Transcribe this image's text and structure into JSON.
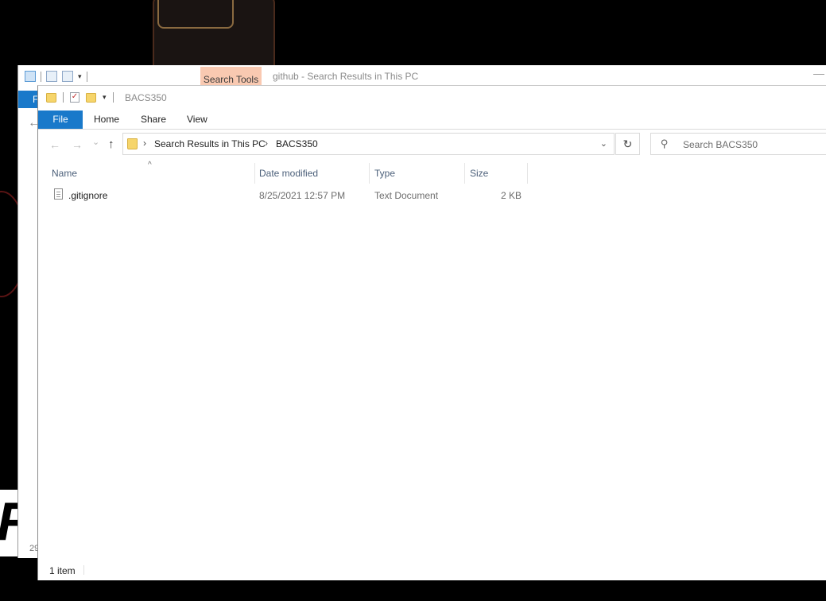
{
  "background_window": {
    "ribbon_context_tab": "Search Tools",
    "title": "github - Search Results in This PC",
    "file_tab_label": "F",
    "partial_status": "29",
    "minimize_glyph": "—",
    "back_glyph": "←"
  },
  "window": {
    "title": "BACS350",
    "qat_dropdown_glyph": "▾"
  },
  "ribbon": {
    "tabs": [
      "File",
      "Home",
      "Share",
      "View"
    ]
  },
  "nav": {
    "back_glyph": "←",
    "forward_glyph": "→",
    "recent_glyph": "⌄",
    "up_glyph": "↑"
  },
  "address": {
    "separator": "›",
    "crumbs": [
      "Search Results in This PC",
      "BACS350"
    ],
    "dropdown_glyph": "⌄",
    "refresh_glyph": "↻"
  },
  "search": {
    "placeholder": "Search BACS350",
    "icon_glyph": "⚲"
  },
  "columns": {
    "sort_glyph": "^",
    "headers": [
      "Name",
      "Date modified",
      "Type",
      "Size"
    ]
  },
  "files": [
    {
      "name": ".gitignore",
      "date": "8/25/2021 12:57 PM",
      "type": "Text Document",
      "size": "2 KB",
      "icon": "text-document-icon"
    }
  ],
  "status": {
    "count": "1 item"
  },
  "wallpaper": {
    "glyph": "R"
  },
  "colors": {
    "accent": "#1979ca",
    "context_tab": "#f9c9b1",
    "folder": "#f6d56b",
    "header_text": "#4c607a"
  }
}
